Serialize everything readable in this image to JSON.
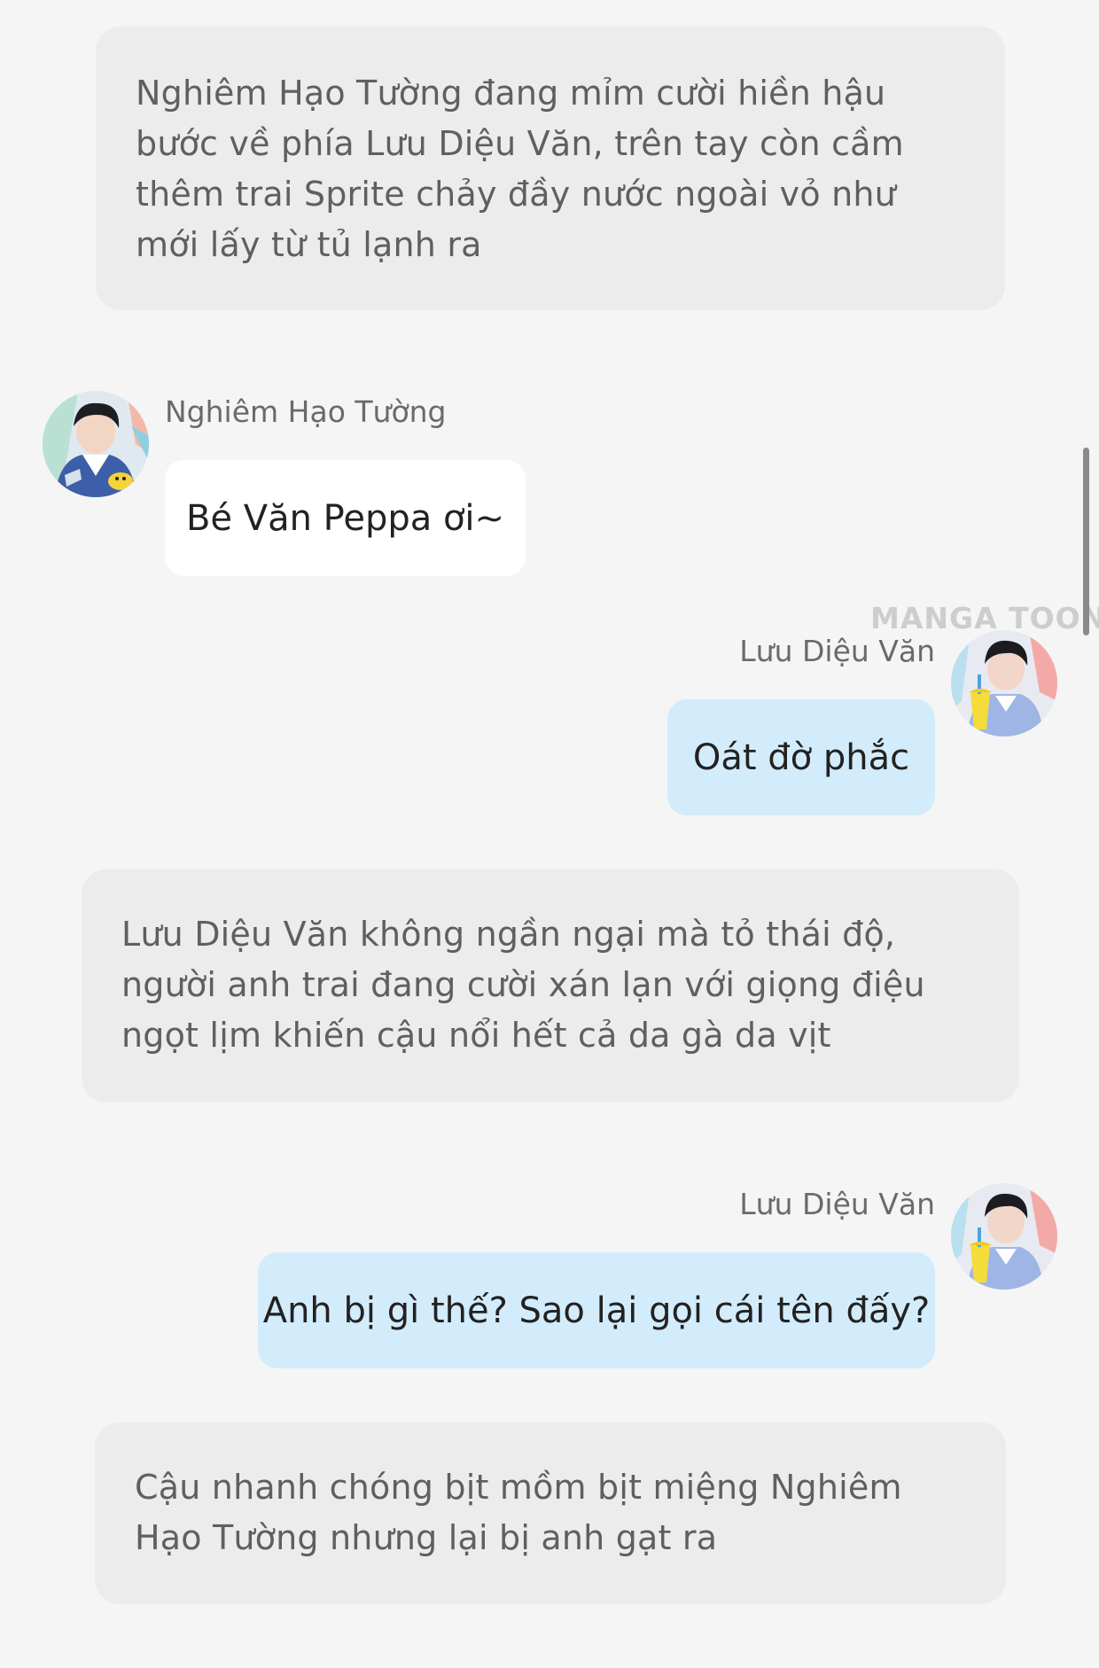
{
  "messages": {
    "narration_1": "Nghiêm Hạo Tường đang mỉm cười hiền hậu bước về phía Lưu Diệu Văn, trên tay còn cầm thêm trai Sprite chảy đầy nước ngoài vỏ như mới lấy từ tủ lạnh ra",
    "chat_1": {
      "speaker": "Nghiêm Hạo Tường",
      "text": "Bé Văn Peppa ơi~"
    },
    "chat_2": {
      "speaker": "Lưu Diệu Văn",
      "text": "Oát đờ phắc"
    },
    "narration_2": "Lưu Diệu Văn không ngần ngại mà tỏ thái độ, người anh trai đang cười xán lạn với giọng điệu ngọt lịm khiến cậu nổi hết cả da gà da vịt",
    "chat_3": {
      "speaker": "Lưu Diệu Văn",
      "text": "Anh bị gì thế? Sao lại gọi cái tên đấy?"
    },
    "narration_3": "Cậu nhanh chóng bịt mồm bịt miệng Nghiêm Hạo Tường nhưng lại bị anh gạt ra"
  },
  "watermark": "MANGA TOON",
  "colors": {
    "background": "#f5f5f5",
    "narration_box": "#ececec",
    "left_bubble": "#ffffff",
    "right_bubble": "#d3ecfb"
  },
  "icons": {
    "avatar_left": "avatar-nghiem-hao-tuong",
    "avatar_right": "avatar-luu-dieu-van"
  }
}
